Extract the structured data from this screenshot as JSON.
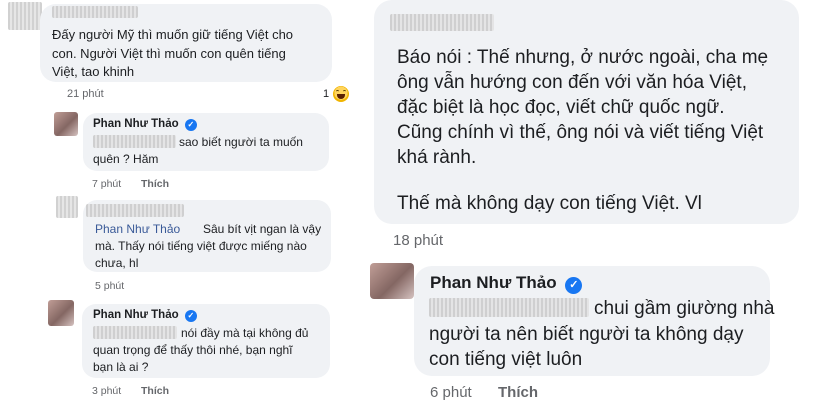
{
  "left": {
    "c1": {
      "text_lines": [
        "Đấy người Mỹ thì muốn giữ tiếng Việt cho",
        "con. Người Việt thì muốn con quên tiếng",
        "Việt, tao khinh"
      ],
      "time": "21 phút",
      "reaction_count": "1",
      "reaction_icon": "haha-emoji-icon"
    },
    "c2": {
      "author": "Phan Như Thảo",
      "text_lines": [
        "sao biết người ta muốn",
        "quên ? Hăm"
      ],
      "time": "7 phút",
      "like": "Thích"
    },
    "c3": {
      "author": "Phan Như Thảo",
      "text_lines": [
        "Sâu bít vịt ngan là vậy",
        "mà. Thấy nói tiếng việt được miếng nào",
        "chưa, hl"
      ],
      "time": "5 phút"
    },
    "c4": {
      "author": "Phan Như Thảo",
      "text_lines": [
        "nói đầy mà tại không đủ",
        "quan trọng để thấy thôi nhé, bạn nghĩ",
        "bạn là ai ?"
      ],
      "time": "3 phút",
      "like": "Thích"
    }
  },
  "right": {
    "c1": {
      "text_lines": [
        "Báo nói : Thế nhưng, ở nước ngoài, cha mẹ",
        "ông vẫn hướng con đến với văn hóa Việt,",
        "đặc biệt là học đọc, viết chữ quốc ngữ.",
        "Cũng chính vì thế, ông nói và viết tiếng Việt",
        "khá rành.",
        "",
        "Thế mà không dạy con tiếng Việt. Vl"
      ],
      "time": "18 phút"
    },
    "c2": {
      "author": "Phan Như Thảo",
      "text_lines": [
        "chui gầm giường nhà",
        "người ta nên biết người ta không dạy",
        "con tiếng việt luôn"
      ],
      "time": "6 phút",
      "like": "Thích"
    }
  },
  "colors": {
    "bubble": "#f0f2f5",
    "meta": "#65676b",
    "verified": "#1877f2",
    "name_blue": "#3a5a98"
  }
}
